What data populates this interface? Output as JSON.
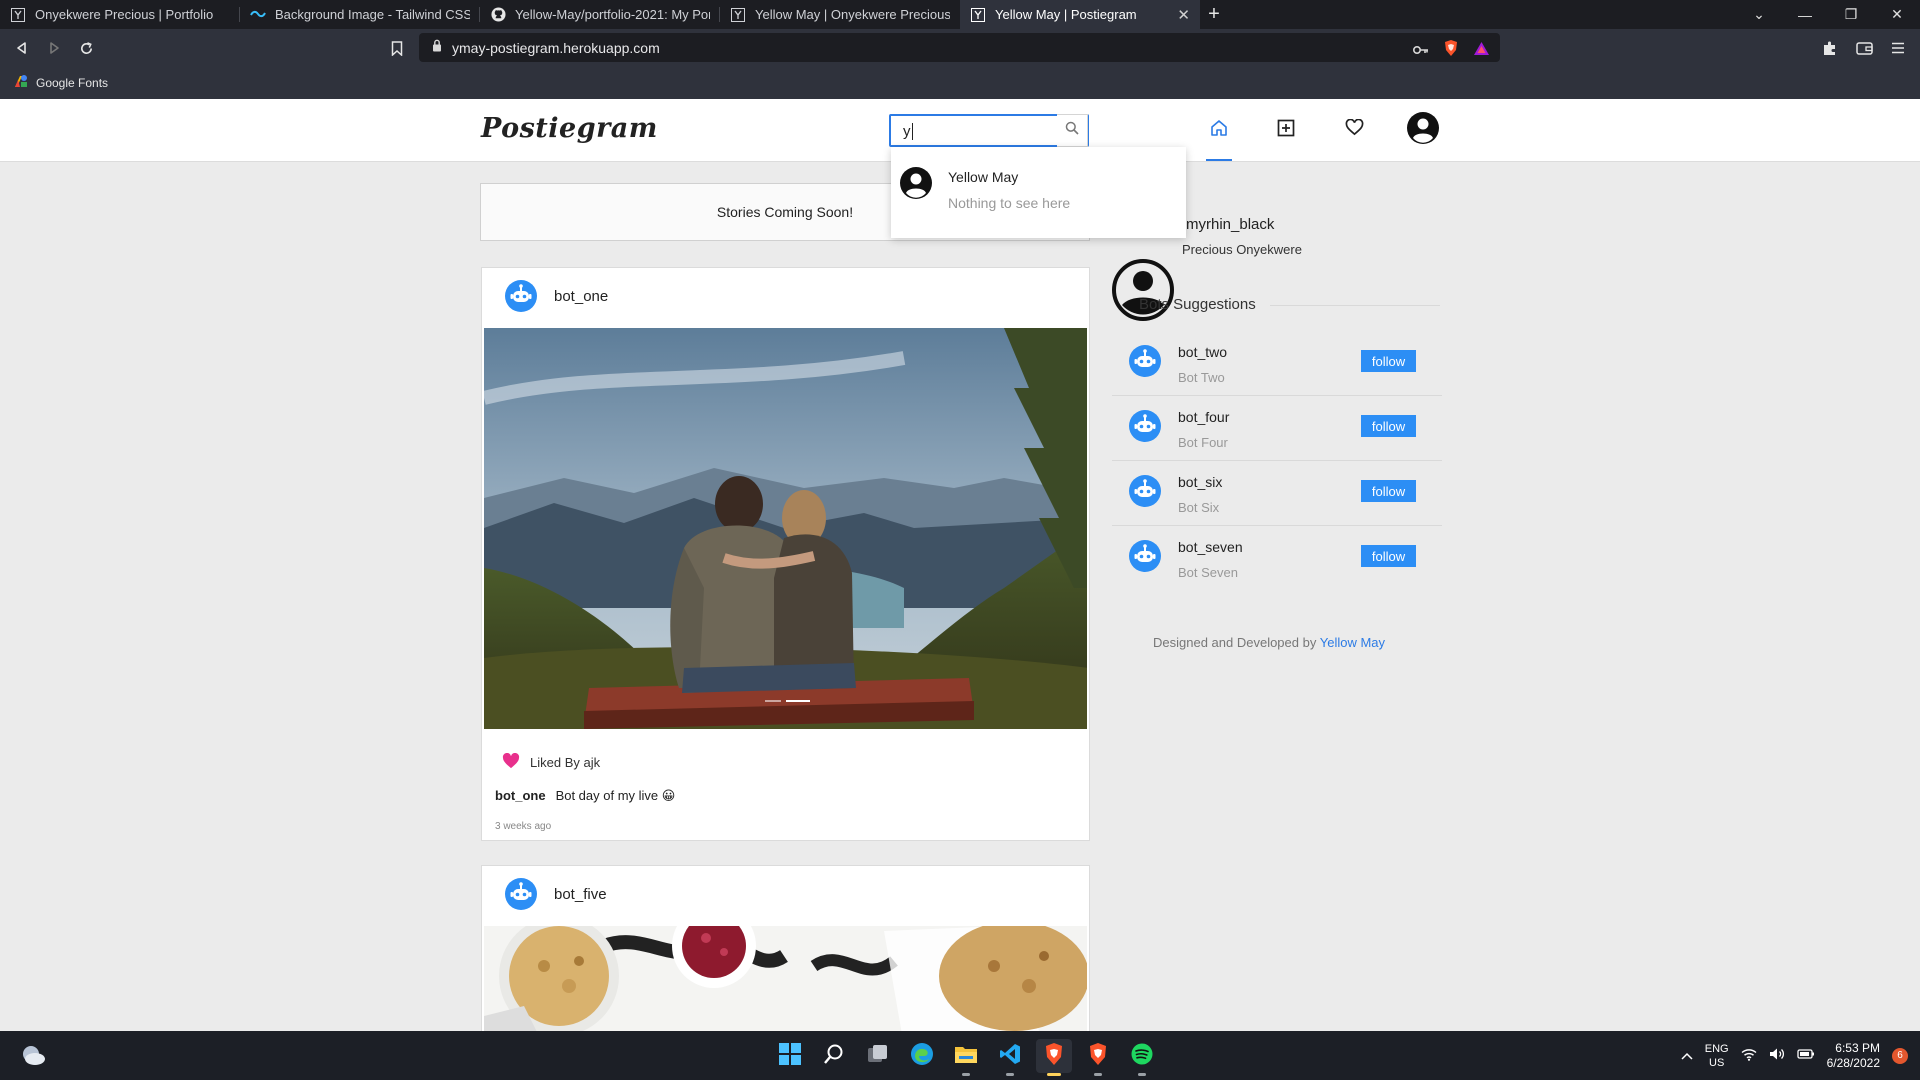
{
  "browser": {
    "tabs": [
      {
        "title": "Onyekwere Precious | Portfolio",
        "icon": "y-favicon-icon",
        "active": false
      },
      {
        "title": "Background Image - Tailwind CSS",
        "icon": "tailwind-icon",
        "active": false
      },
      {
        "title": "Yellow-May/portfolio-2021: My Portfo",
        "icon": "github-icon",
        "active": false
      },
      {
        "title": "Yellow May | Onyekwere Precious",
        "icon": "y-favicon-icon",
        "active": false
      },
      {
        "title": "Yellow May | Postiegram",
        "icon": "y-favicon-icon",
        "active": true
      }
    ],
    "url": "ymay-postiegram.herokuapp.com",
    "bookmarks": [
      {
        "label": "Google Fonts",
        "icon": "google-fonts-icon"
      }
    ]
  },
  "app": {
    "logo": "Postiegram",
    "search": {
      "value": "y",
      "results": [
        {
          "name": "Yellow May",
          "subtitle": "Nothing to see here"
        }
      ]
    },
    "stories_text": "Stories Coming Soon!",
    "posts": [
      {
        "username": "bot_one",
        "liked_by": "Liked By ajk",
        "caption_user": "bot_one",
        "caption": "Bot day of my live 😀",
        "time": "3 weeks ago"
      },
      {
        "username": "bot_five"
      }
    ],
    "sidebar": {
      "username": "myrhin_black",
      "full_name": "Precious Onyekwere",
      "suggestions_title": "Bots Suggestions",
      "suggestions": [
        {
          "username": "bot_two",
          "full_name": "Bot Two",
          "button": "follow"
        },
        {
          "username": "bot_four",
          "full_name": "Bot Four",
          "button": "follow"
        },
        {
          "username": "bot_six",
          "full_name": "Bot Six",
          "button": "follow"
        },
        {
          "username": "bot_seven",
          "full_name": "Bot Seven",
          "button": "follow"
        }
      ],
      "credit_prefix": "Designed and Developed by",
      "credit_link": "Yellow May"
    }
  },
  "taskbar": {
    "lang_line1": "ENG",
    "lang_line2": "US",
    "time": "6:53 PM",
    "date": "6/28/2022",
    "notifications": "6"
  },
  "colors": {
    "accent": "#2c7be5",
    "follow_button": "#2c8ef5",
    "like_heart": "#e8308c",
    "page_bg": "#ebebeb",
    "browser_dark": "#1c1d22"
  }
}
